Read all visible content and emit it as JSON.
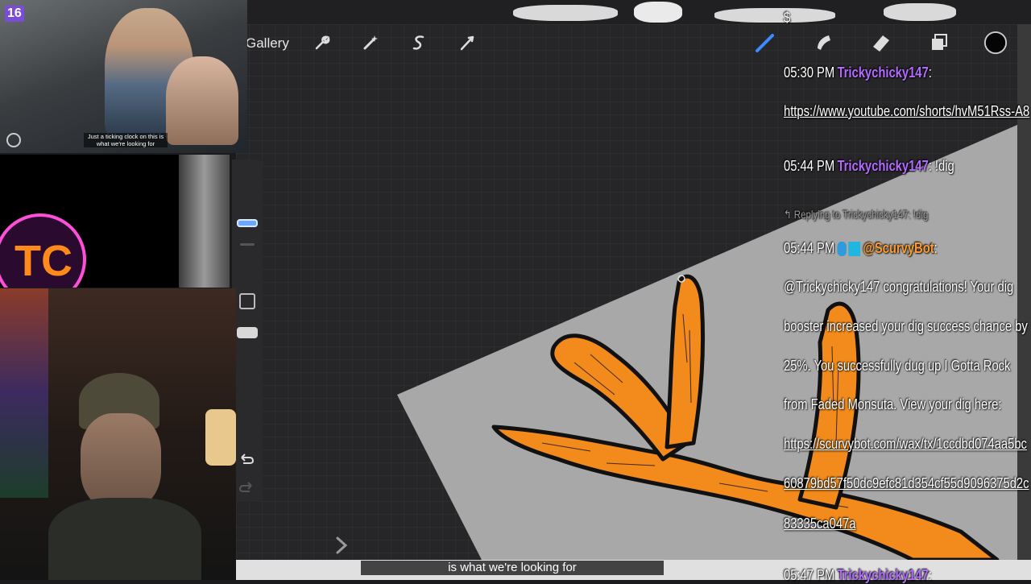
{
  "stream": {
    "view_count": "16",
    "video_caption": "Just a ticking clock on this is what we're looking for",
    "bottom_caption": "is what we're looking for"
  },
  "toolbar": {
    "gallery_label": "Gallery",
    "icons": [
      "wrench-icon",
      "magic-wand-icon",
      "selection-s-icon",
      "transform-arrow-icon",
      "brush-icon",
      "smudge-icon",
      "eraser-icon",
      "layers-icon",
      "color-circle-icon"
    ]
  },
  "chat": {
    "top_fragment": "$",
    "messages": [
      {
        "time": "05:30 PM",
        "user": "Trickychicky147",
        "sep": ":",
        "text": ""
      },
      {
        "link": "https://www.youtube.com/shorts/hvM51Rss-A8"
      },
      {
        "time": "05:44 PM",
        "user": "Trickychicky147",
        "sep": ":",
        "text": " !dig"
      },
      {
        "reply": "↰ Replying to Trickychicky147: !dig"
      },
      {
        "time": "05:44 PM",
        "user": "@ScurvyBot",
        "sep": ":",
        "text": ""
      },
      {
        "text": "@Trickychicky147 congratulations! Your dig"
      },
      {
        "text": "booster increased your dig success chance by"
      },
      {
        "text": "25%. You successfully dug up I Gotta Rock"
      },
      {
        "text": "from Faded Monsuta. View your dig here:"
      },
      {
        "link": "https://scurvybot.com/wax/tx/1ccdbd074aa5bc"
      },
      {
        "link": "60879bd57f50dc9efc81d354cf55d9096375d2c"
      },
      {
        "link": "83335ca047a"
      },
      {
        "time": "05:47 PM",
        "user": "Trickychicky147",
        "sep": ":",
        "text": ""
      }
    ]
  },
  "colors": {
    "antler_fill": "#f28a1c",
    "antler_outline": "#111111",
    "paper": "#a9a9a9",
    "username": "#b36bff",
    "bot_name": "#ff9b30",
    "slider_accent": "#6aa8ff"
  }
}
